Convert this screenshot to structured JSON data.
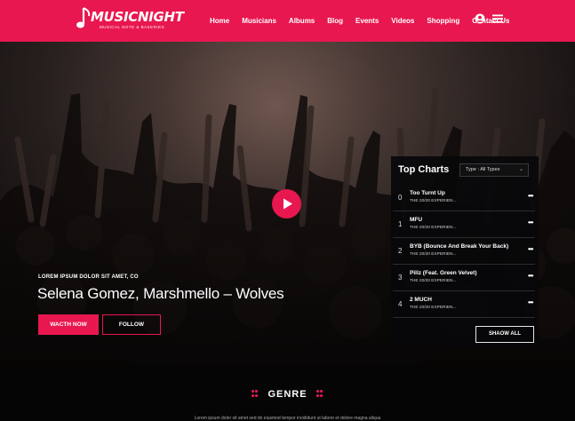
{
  "header": {
    "logo_title": "MUSICNIGHT",
    "logo_subtitle": "MUSICAL NOTE & BAKERIES",
    "nav": [
      {
        "label": "Home"
      },
      {
        "label": "Musicians"
      },
      {
        "label": "Albums"
      },
      {
        "label": "Blog"
      },
      {
        "label": "Events"
      },
      {
        "label": "Videos"
      },
      {
        "label": "Shopping"
      },
      {
        "label": "Contact Us"
      }
    ],
    "icons": [
      "user-icon",
      "menu-icon"
    ]
  },
  "hero": {
    "eyebrow": "LOREM IPSUM DOLOR SIT AMET, CO",
    "title": "Selena Gomez, Marshmello – Wolves",
    "watch_label": "WACTH NOW",
    "follow_label": "FOLLOW",
    "play_icon": "play-icon"
  },
  "top_charts": {
    "title": "Top Charts",
    "select_value": "Type : All Types",
    "items": [
      {
        "rank": "0",
        "song": "Too Turnt Up",
        "artist": "THE 20/20 EXPERIEN..."
      },
      {
        "rank": "1",
        "song": "MFU",
        "artist": "THE 20/20 EXPERIEN..."
      },
      {
        "rank": "2",
        "song": "BYB (Bounce And Break Your Back)",
        "artist": "THE 20/20 EXPERIEN..."
      },
      {
        "rank": "3",
        "song": "Pillz (Feat. Green Velvet)",
        "artist": "THE 20/20 EXPERIEN..."
      },
      {
        "rank": "4",
        "song": "2 MUCH",
        "artist": "THE 20/20 EXPERIEN..."
      }
    ],
    "more_glyph": "•••",
    "show_all_label": "SHAOW ALL"
  },
  "genre": {
    "title": "GENRE",
    "text": "Lorem ipsum dolor sit amet sed do eiusmod tempor incididunt ut labore et dolore magna aliqua"
  },
  "colors": {
    "accent": "#e8174f",
    "background": "#0b0b0d",
    "panel": "#08080a"
  }
}
